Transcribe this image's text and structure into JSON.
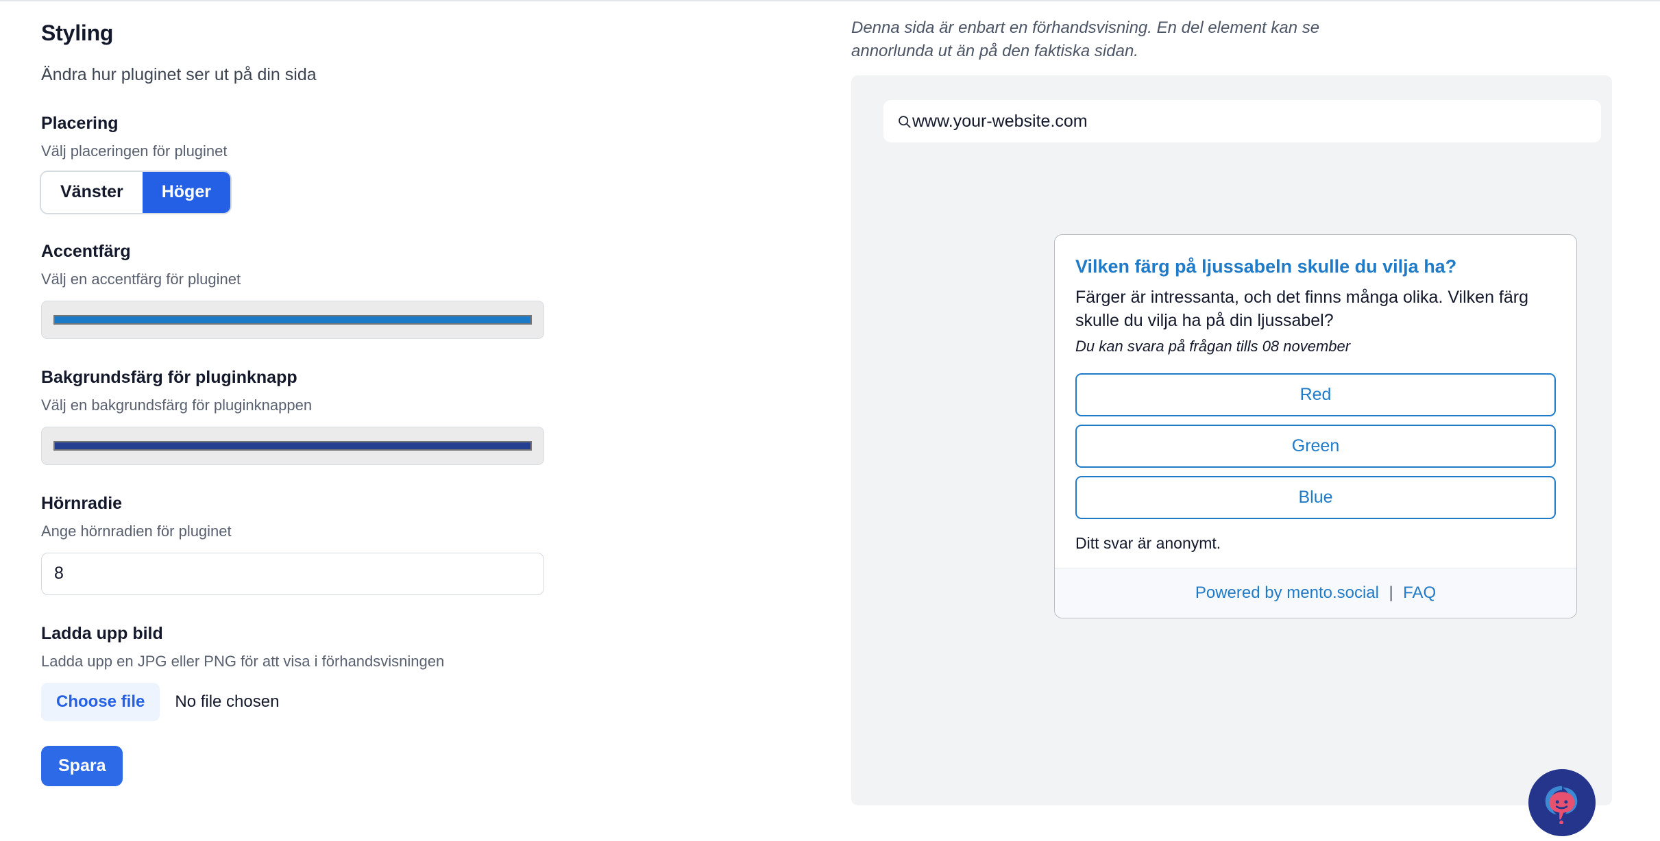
{
  "settings": {
    "title": "Styling",
    "subtitle": "Ändra hur pluginet ser ut på din sida",
    "placement": {
      "label": "Placering",
      "hint": "Välj placeringen för pluginet",
      "options": [
        "Vänster",
        "Höger"
      ],
      "selected": "Höger"
    },
    "accent_color": {
      "label": "Accentfärg",
      "hint": "Välj en accentfärg för pluginet",
      "value": "#1a7ac8"
    },
    "button_bg_color": {
      "label": "Bakgrundsfärg för pluginknapp",
      "hint": "Välj en bakgrundsfärg för pluginknappen",
      "value": "#243f8f"
    },
    "corner_radius": {
      "label": "Hörnradie",
      "hint": "Ange hörnradien för pluginet",
      "value": "8"
    },
    "image_upload": {
      "label": "Ladda upp bild",
      "hint": "Ladda upp en JPG eller PNG för att visa i förhandsvisningen",
      "choose_label": "Choose file",
      "file_status": "No file chosen"
    },
    "save_label": "Spara"
  },
  "preview": {
    "note": "Denna sida är enbart en förhandsvisning. En del element kan se annorlunda ut än på den faktiska sidan.",
    "url_bar": {
      "icon": "search-icon",
      "value": "www.your-website.com"
    },
    "poll": {
      "question": "Vilken färg på ljussabeln skulle du vilja ha?",
      "description": "Färger är intressanta, och det finns många olika. Vilken färg skulle du vilja ha på din ljussabel?",
      "deadline": "Du kan svara på frågan tills 08 november",
      "options": [
        "Red",
        "Green",
        "Blue"
      ],
      "anonymous_note": "Ditt svar är anonymt.",
      "footer": {
        "powered_by": "Powered by mento.social",
        "separator": "|",
        "faq": "FAQ"
      }
    },
    "fab": {
      "icon": "chat-bubble-face-icon",
      "background": "#25358c"
    }
  }
}
